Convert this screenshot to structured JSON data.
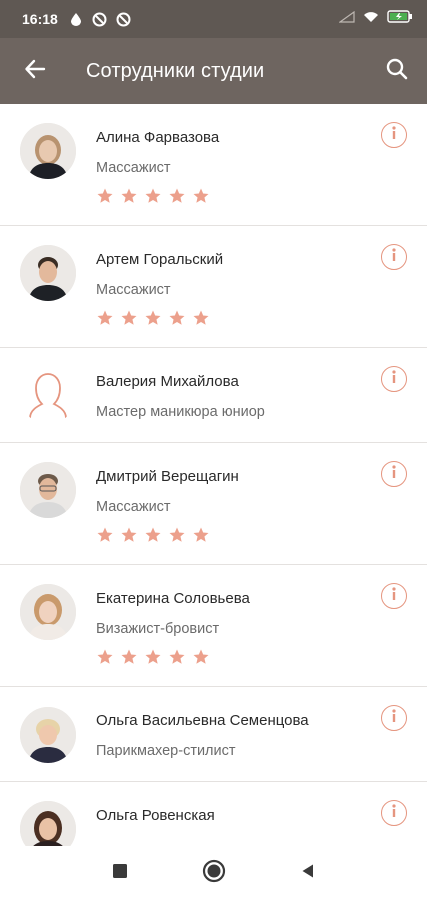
{
  "status_bar": {
    "time": "16:18",
    "icons": [
      "drop-icon",
      "app-icon",
      "app-icon-2",
      "signal-icon",
      "wifi-icon",
      "battery-icon"
    ]
  },
  "app_bar": {
    "title": "Сотрудники студии",
    "back_icon": "arrow-back-icon",
    "search_icon": "search-icon"
  },
  "colors": {
    "status_bar_bg": "#5f5853",
    "app_bar_bg": "#6e6560",
    "accent": "#e5957f",
    "star": "#eca08c"
  },
  "employees": [
    {
      "name": "Алина Фарвазова",
      "role": "Массажист",
      "rating": 5,
      "avatar": "photo"
    },
    {
      "name": "Артем Горальский",
      "role": "Массажист",
      "rating": 5,
      "avatar": "photo"
    },
    {
      "name": "Валерия Михайлова",
      "role": "Мастер маникюра юниор",
      "rating": null,
      "avatar": "placeholder"
    },
    {
      "name": "Дмитрий Верещагин",
      "role": "Массажист",
      "rating": 5,
      "avatar": "photo"
    },
    {
      "name": "Екатерина Соловьева",
      "role": "Визажист-бровист",
      "rating": 5,
      "avatar": "photo"
    },
    {
      "name": "Ольга Васильевна Семенцова",
      "role": "Парикмахер-стилист",
      "rating": null,
      "avatar": "photo"
    },
    {
      "name": "Ольга Ровенская",
      "role": "",
      "rating": null,
      "avatar": "photo"
    }
  ],
  "nav_bar": {
    "icons": [
      "recents-square-icon",
      "home-circle-icon",
      "back-triangle-icon"
    ]
  }
}
